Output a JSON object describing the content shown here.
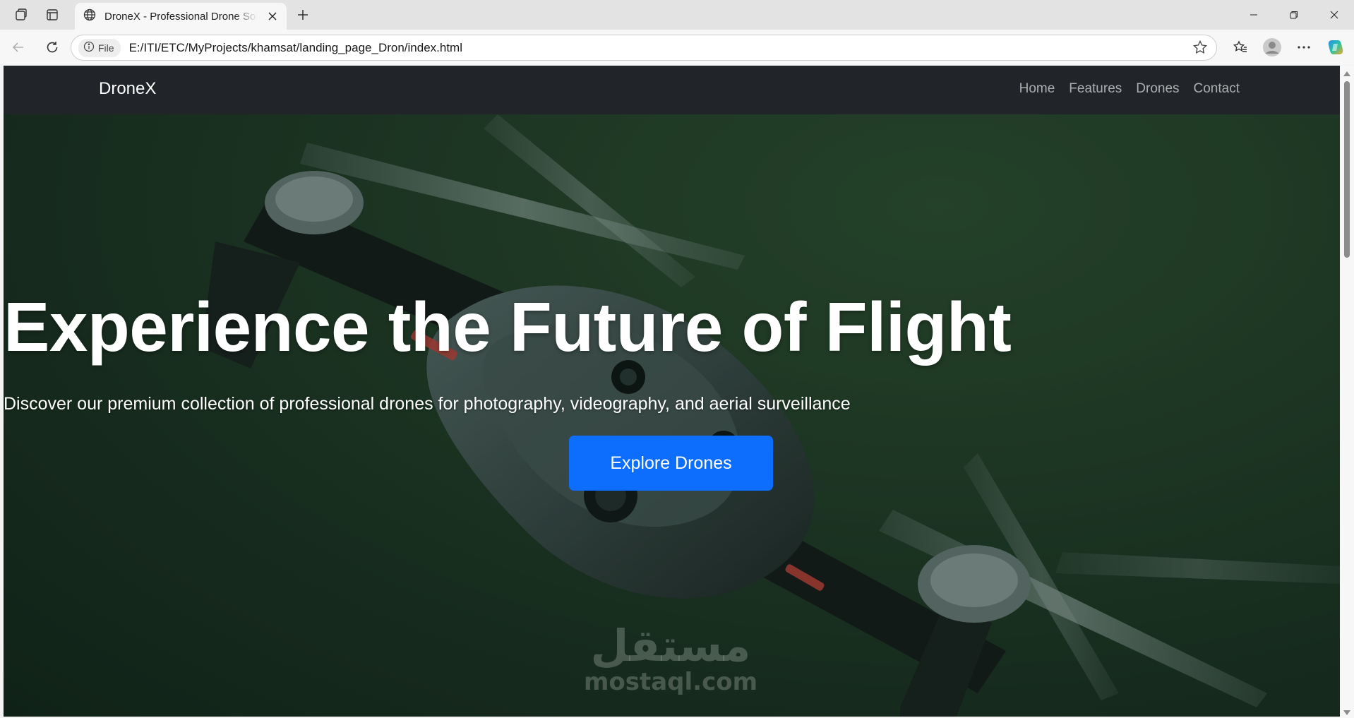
{
  "browser": {
    "tab": {
      "title": "DroneX - Professional Drone Solutions"
    },
    "address_bar": {
      "site_chip": "File",
      "url": "E:/ITI/ETC/MyProjects/khamsat/landing_page_Dron/index.html"
    },
    "icons": {
      "workspaces": "workspaces-icon",
      "tab_actions": "tab-actions-icon",
      "tab_favicon": "globe-icon",
      "close": "close-icon",
      "new_tab": "plus-icon",
      "back": "back-arrow-icon",
      "reload": "reload-icon",
      "info": "info-icon",
      "favorite": "star-icon",
      "favorites": "favorites-icon",
      "profile": "profile-icon",
      "more": "more-icon",
      "copilot": "copilot-icon"
    }
  },
  "site": {
    "brand": "DroneX",
    "nav": [
      "Home",
      "Features",
      "Drones",
      "Contact"
    ],
    "hero": {
      "title": "Experience the Future of Flight",
      "subtitle": "Discover our premium collection of professional drones for photography, videography, and aerial surveillance",
      "cta": "Explore Drones"
    },
    "watermark": {
      "arabic": "مستقل",
      "latin": "mostaql.com"
    },
    "colors": {
      "navbar": "#212529",
      "cta": "#0d6efd",
      "hero_tint": "#1c3524"
    }
  }
}
